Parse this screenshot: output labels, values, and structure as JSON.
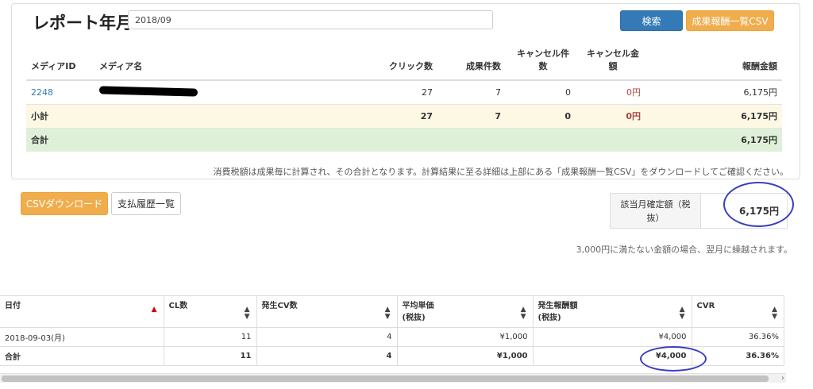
{
  "header": {
    "title": "レポート年月",
    "month_value": "2018/09",
    "search_label": "検索",
    "csv_label": "成果報酬一覧CSV"
  },
  "report_table": {
    "headers": {
      "media_id": "メディアID",
      "media_name": "メディア名",
      "clicks": "クリック数",
      "conversions": "成果件数",
      "cancel_count": "キャンセル件数",
      "cancel_amount": "キャンセル金額",
      "reward": "報酬金額"
    },
    "rows": [
      {
        "media_id": "2248",
        "clicks": "27",
        "conversions": "7",
        "cancel_count": "0",
        "cancel_amount": "0円",
        "reward": "6,175円"
      }
    ],
    "subtotal": {
      "label": "小計",
      "clicks": "27",
      "conversions": "7",
      "cancel_count": "0",
      "cancel_amount": "0円",
      "reward": "6,175円"
    },
    "total": {
      "label": "合計",
      "reward": "6,175円"
    }
  },
  "tax_note": "消費税額は成果毎に計算され、その合計となります。計算結果に至る詳細は上部にある「成果報酬一覧CSV」をダウンロードしてご確認ください。",
  "actions": {
    "csv_download_label": "CSVダウンロード",
    "payment_history_label": "支払履歴一覧"
  },
  "confirmed": {
    "label": "該当月確定額（税抜）",
    "value": "6,175円"
  },
  "carryover_note": "3,000円に満たない金額の場合、翌月に繰越されます。",
  "daily_table": {
    "headers": {
      "date": "日付",
      "cl": "CL数",
      "cv": "発生CV数",
      "avg_price": "平均単価",
      "avg_price_sub": "(税抜)",
      "reward": "発生報酬額",
      "reward_sub": "(税抜)",
      "cvr": "CVR"
    },
    "rows": [
      {
        "date": "2018-09-03(月)",
        "cl": "11",
        "cv": "4",
        "avg_price": "¥1,000",
        "reward": "¥4,000",
        "cvr": "36.36%"
      }
    ],
    "total": {
      "label": "合計",
      "cl": "11",
      "cv": "4",
      "avg_price": "¥1,000",
      "reward": "¥4,000",
      "cvr": "36.36%"
    }
  },
  "colors": {
    "primary": "#337ab7",
    "warning": "#f0ad4e",
    "subtotal_bg": "#fcf8e3",
    "total_bg": "#dff0d8",
    "annotation": "#3a3fc0"
  }
}
